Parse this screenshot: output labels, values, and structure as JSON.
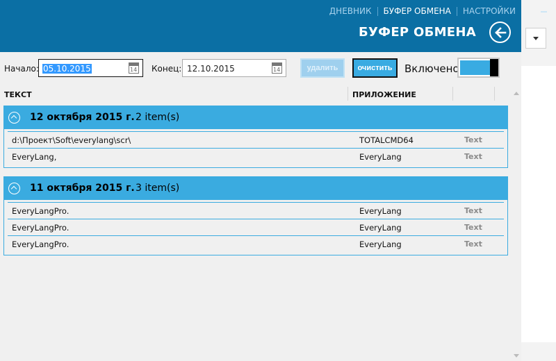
{
  "nav": {
    "diary": "ДНЕВНИК",
    "clipboard": "БУФЕР ОБМЕНА",
    "settings": "НАСТРОЙКИ"
  },
  "header": {
    "title": "БУФЕР ОБМЕНА"
  },
  "filters": {
    "start_label": "Начало:",
    "start_value": "05.10.2015",
    "end_label": "Конец:",
    "end_value": "12.10.2015",
    "calendar_day": "14",
    "delete_label": "удалить",
    "clear_label": "очистить",
    "toggle_label": "Включено"
  },
  "columns": {
    "text": "ТЕКСТ",
    "app": "ПРИЛОЖЕНИЕ"
  },
  "groups": [
    {
      "date": "12 октября 2015 г.",
      "count": "2 item(s)",
      "rows": [
        {
          "text": "d:\\Проект\\Soft\\everylang\\scr\\",
          "app": "TOTALCMD64",
          "format": "Text"
        },
        {
          "text": "EveryLang,",
          "app": "EveryLang",
          "format": "Text"
        }
      ]
    },
    {
      "date": "11 октября 2015 г.",
      "count": "3 item(s)",
      "rows": [
        {
          "text": "EveryLangPro.",
          "app": "EveryLang",
          "format": "Text"
        },
        {
          "text": "EveryLangPro.",
          "app": "EveryLang",
          "format": "Text"
        },
        {
          "text": "EveryLangPro.",
          "app": "EveryLang",
          "format": "Text"
        }
      ]
    }
  ],
  "colors": {
    "header_bg": "#0b6fa4",
    "accent": "#3aabe0",
    "toggle_on": "#39abe2"
  }
}
